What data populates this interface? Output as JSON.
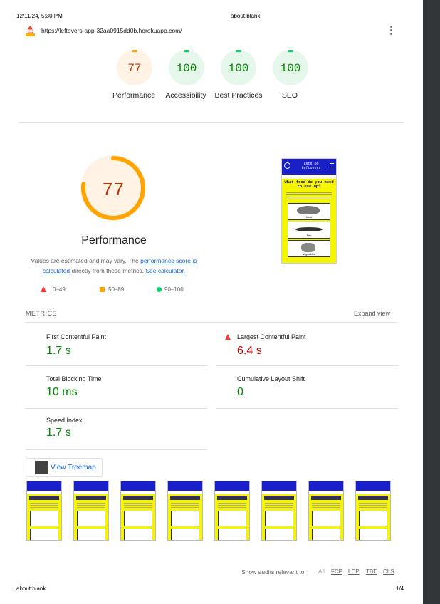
{
  "header": {
    "datetime": "12/11/24, 5:30 PM",
    "title": "about:blank"
  },
  "urlbar": {
    "url": "https://leftovers-app-32aa0915dd0b.herokuapp.com/"
  },
  "gauges": [
    {
      "score": "77",
      "label": "Performance",
      "color": "#c33300",
      "ring": "#fff3e6",
      "arc": "#ffa400"
    },
    {
      "score": "100",
      "label": "Accessibility",
      "color": "#008800",
      "ring": "#e6f7ec",
      "arc": "#0cce6b"
    },
    {
      "score": "100",
      "label": "Best Practices",
      "color": "#008800",
      "ring": "#e6f7ec",
      "arc": "#0cce6b"
    },
    {
      "score": "100",
      "label": "SEO",
      "color": "#008800",
      "ring": "#e6f7ec",
      "arc": "#0cce6b"
    }
  ],
  "perf": {
    "score": "77",
    "score_fraction": 0.77,
    "title": "Performance",
    "desc_prefix": "Values are estimated and may vary. The ",
    "desc_link1": "performance score is calculated",
    "desc_mid": " directly from these metrics. ",
    "desc_link2": "See calculator."
  },
  "legend": {
    "fail": "0–49",
    "average": "50–89",
    "pass": "90–100"
  },
  "metrics": {
    "heading": "METRICS",
    "expand": "Expand view",
    "items": [
      {
        "title": "First Contentful Paint",
        "value": "1.7 s",
        "status": "pass"
      },
      {
        "title": "Largest Contentful Paint",
        "value": "6.4 s",
        "status": "fail"
      },
      {
        "title": "Total Blocking Time",
        "value": "10 ms",
        "status": "pass"
      },
      {
        "title": "Cumulative Layout Shift",
        "value": "0",
        "status": "pass"
      },
      {
        "title": "Speed Index",
        "value": "1.7 s",
        "status": "pass"
      }
    ]
  },
  "treemap_button": "View Treemap",
  "screenshot": {
    "brand": "Lets Do Leftovers",
    "question": "What food do you need to use up?",
    "items": [
      "Meat",
      "Fish",
      "Vegetables"
    ]
  },
  "filmstrip_count": 8,
  "audits": {
    "label": "Show audits relevant to:",
    "filters": [
      "All",
      "FCP",
      "LCP",
      "TBT",
      "CLS"
    ]
  },
  "footer": {
    "left": "about:blank",
    "right": "1/4"
  },
  "colors": {
    "pass": "#008800",
    "fail": "#cc0000",
    "average": "#c33300"
  }
}
